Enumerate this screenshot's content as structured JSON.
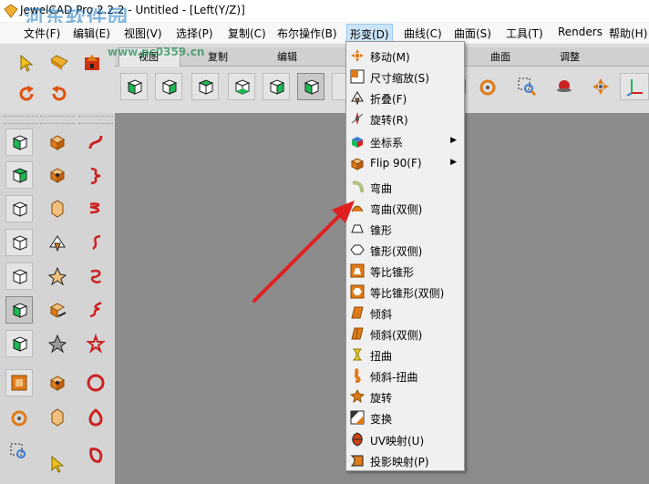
{
  "window": {
    "title": "JewelCAD Pro 2.2.2 - Untitled - [Left(Y/Z)]",
    "watermark": "河东软件园",
    "watermark_url": "www.pc0359.cn"
  },
  "menubar": [
    "文件(F)",
    "编辑(E)",
    "视图(V)",
    "选择(P)",
    "复制(C)",
    "布尔操作(B)",
    "形变(D)",
    "曲线(C)",
    "曲面(S)",
    "工具(T)",
    "Renders",
    "帮助(H)"
  ],
  "tabs": [
    "视图",
    "复制",
    "编辑",
    "曲面",
    "调整"
  ],
  "transform_menu": [
    {
      "label": "移动(M)",
      "icon": "move-icon",
      "color": "#e07b1a"
    },
    {
      "label": "尺寸缩放(S)",
      "icon": "scale-icon",
      "color": "#e07b1a"
    },
    {
      "label": "折叠(F)",
      "icon": "fold-icon",
      "color": "#555555"
    },
    {
      "label": "旋转(R)",
      "icon": "rotate-icon",
      "color": "#cc2222"
    },
    {
      "label": "坐标系",
      "icon": "coordinate-icon",
      "color": "#3a7bd5",
      "submenu": true
    },
    {
      "label": "Flip 90(F)",
      "icon": "flip-icon",
      "color": "#e07b1a",
      "submenu": true
    },
    {
      "label": "弯曲",
      "icon": "bend-icon",
      "color": "#b0c080"
    },
    {
      "label": "弯曲(双侧)",
      "icon": "bend-double-icon",
      "color": "#e07b1a"
    },
    {
      "label": "锥形",
      "icon": "taper-icon",
      "color": "#f0f0f0"
    },
    {
      "label": "锥形(双侧)",
      "icon": "taper-double-icon",
      "color": "#f0f0f0"
    },
    {
      "label": "等比锥形",
      "icon": "proportional-taper-icon",
      "color": "#e07b1a"
    },
    {
      "label": "等比锥形(双侧)",
      "icon": "proportional-taper-double-icon",
      "color": "#e07b1a"
    },
    {
      "label": "倾斜",
      "icon": "slant-icon",
      "color": "#e07b1a"
    },
    {
      "label": "倾斜(双侧)",
      "icon": "slant-double-icon",
      "color": "#e07b1a"
    },
    {
      "label": "扭曲",
      "icon": "twist-icon",
      "color": "#e6d020"
    },
    {
      "label": "倾斜-扭曲",
      "icon": "slant-twist-icon",
      "color": "#e07b1a"
    },
    {
      "label": "旋转",
      "icon": "spin-icon",
      "color": "#e07b1a"
    },
    {
      "label": "变换",
      "icon": "transform-icon",
      "color": "#333333"
    },
    {
      "label": "UV映射(U)",
      "icon": "uv-map-icon",
      "color": "#cc4411"
    },
    {
      "label": "投影映射(P)",
      "icon": "projection-map-icon",
      "color": "#e07b1a"
    }
  ],
  "colors": {
    "accent_orange": "#e07b1a",
    "viewport_gray": "#8c8c8c",
    "arrow_red": "#e02020",
    "cube_green": "#1db954"
  }
}
